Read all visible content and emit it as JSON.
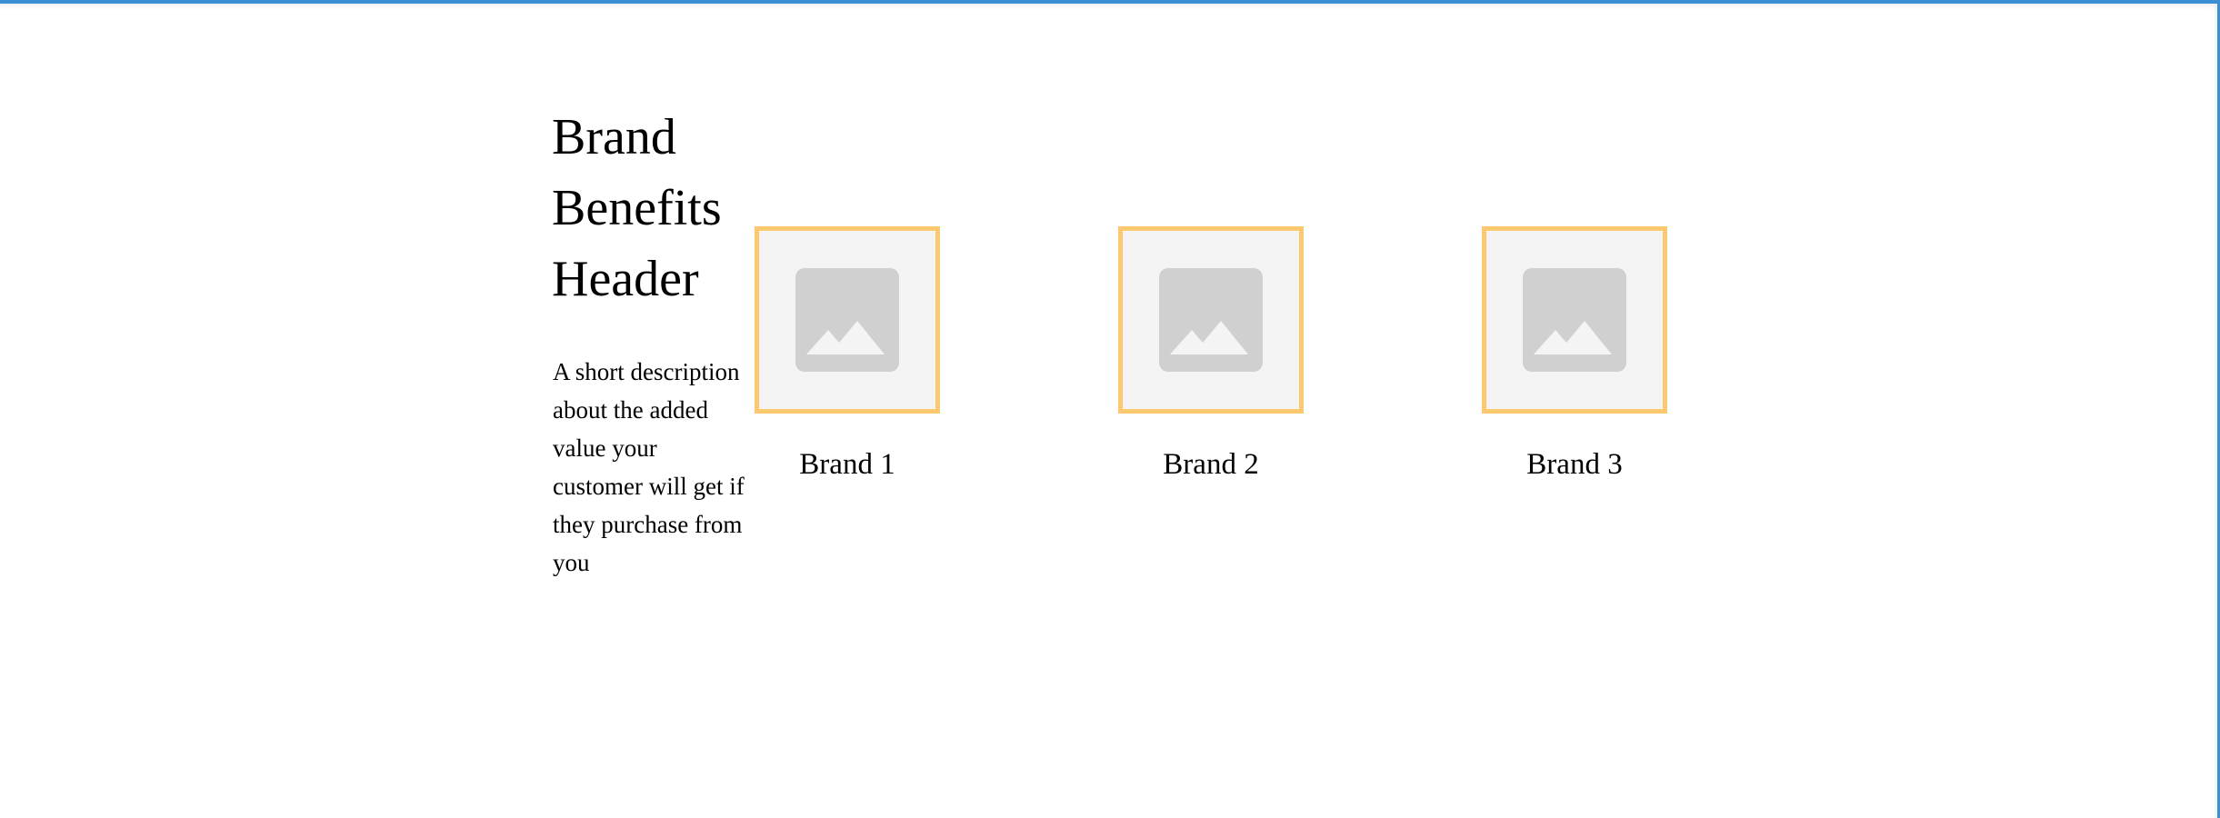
{
  "section": {
    "header": "Brand Benefits Header",
    "description": "A short description about the added value your customer will get if they purchase from you"
  },
  "brands": [
    {
      "label": "Brand 1",
      "icon": "image-placeholder-icon"
    },
    {
      "label": "Brand 2",
      "icon": "image-placeholder-icon"
    },
    {
      "label": "Brand 3",
      "icon": "image-placeholder-icon"
    }
  ],
  "colors": {
    "frame": "#3a8fd6",
    "thumb_border": "#fcc870",
    "thumb_bg": "#f4f4f4",
    "placeholder": "#d0d0d0"
  }
}
